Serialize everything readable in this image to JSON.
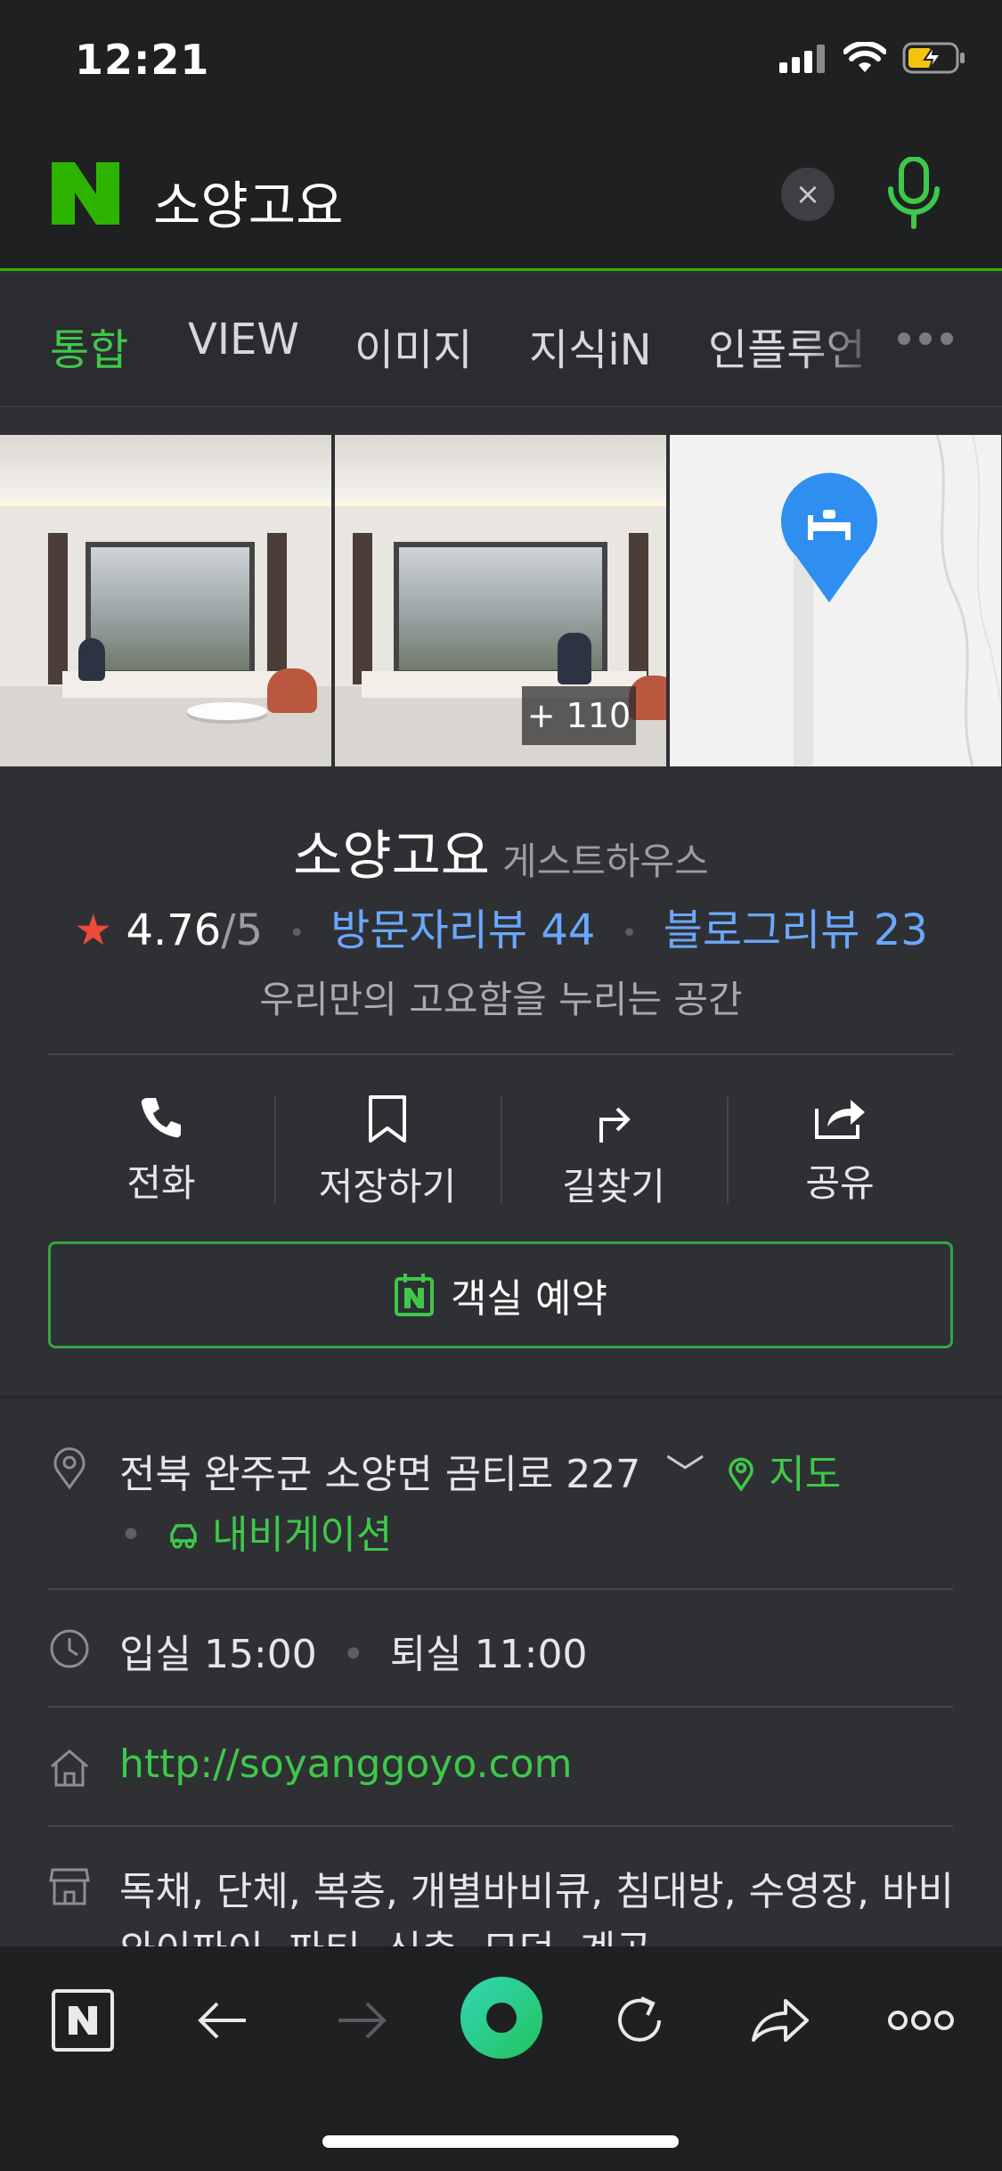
{
  "status_bar": {
    "time": "12:21"
  },
  "search": {
    "query": "소양고요",
    "clear_label": "×"
  },
  "tabs": [
    {
      "label": "통합",
      "active": true
    },
    {
      "label": "VIEW"
    },
    {
      "label": "이미지"
    },
    {
      "label": "지식iN"
    },
    {
      "label": "인플루언"
    }
  ],
  "photos": {
    "more_count": "+ 110"
  },
  "place": {
    "name": "소양고요",
    "category": "게스트하우스",
    "rating": "4.76",
    "rating_max": "/5",
    "visitor_reviews": "방문자리뷰 44",
    "blog_reviews": "블로그리뷰 23",
    "description": "우리만의 고요함을 누리는 공간"
  },
  "actions": [
    {
      "label": "전화",
      "icon": "phone-icon"
    },
    {
      "label": "저장하기",
      "icon": "bookmark-icon"
    },
    {
      "label": "길찾기",
      "icon": "directions-icon"
    },
    {
      "label": "공유",
      "icon": "share-icon"
    }
  ],
  "reserve_label": "객실 예약",
  "info": {
    "address": "전북 완주군 소양면 곰티로 227",
    "map_link": "지도",
    "navigation_link": "내비게이션",
    "checkin": "입실 15:00",
    "checkout": "퇴실 11:00",
    "website": "http://soyanggoyo.com",
    "facilities": "독채, 단체, 복층, 개별바비큐, 침대방, 수영장, 바비큐장,",
    "facilities_cont": "와이파이, 파티, 신축, 모던, 계곡"
  },
  "colors": {
    "accent_green": "#3ec84a",
    "link_blue": "#6aa8ff",
    "star_red": "#ee4a3c"
  }
}
